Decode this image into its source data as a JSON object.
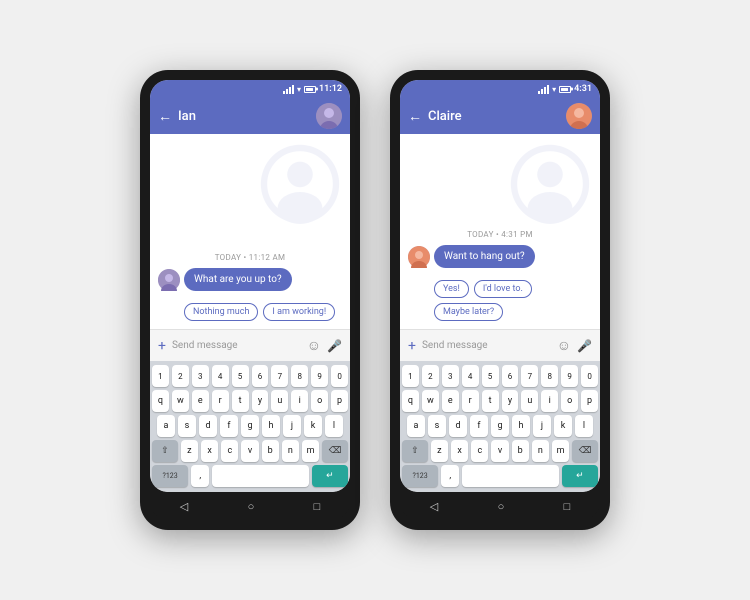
{
  "phone1": {
    "status_time": "11:12",
    "contact_name": "Ian",
    "date_label": "TODAY • 11:12 AM",
    "message": "What are you up to?",
    "smart_replies": [
      "Nothing much",
      "I am working!"
    ],
    "input_placeholder": "Send message"
  },
  "phone2": {
    "status_time": "4:31",
    "contact_name": "Claire",
    "date_label": "TODAY • 4:31 PM",
    "message": "Want to hang out?",
    "smart_replies": [
      "Yes!",
      "I'd love to.",
      "Maybe later?"
    ],
    "input_placeholder": "Send message"
  },
  "keyboard": {
    "row1": [
      "1",
      "2",
      "3",
      "4",
      "5",
      "6",
      "7",
      "8",
      "9",
      "0"
    ],
    "row2": [
      "q",
      "w",
      "e",
      "r",
      "t",
      "y",
      "u",
      "i",
      "o",
      "p"
    ],
    "row3": [
      "a",
      "s",
      "d",
      "f",
      "g",
      "h",
      "j",
      "k",
      "l"
    ],
    "row4": [
      "z",
      "x",
      "c",
      "v",
      "b",
      "n",
      "m"
    ],
    "num_label": "?123",
    "comma": ",",
    "enter_icon": "↵"
  },
  "nav": {
    "back": "◁",
    "home": "○",
    "recent": "□"
  }
}
